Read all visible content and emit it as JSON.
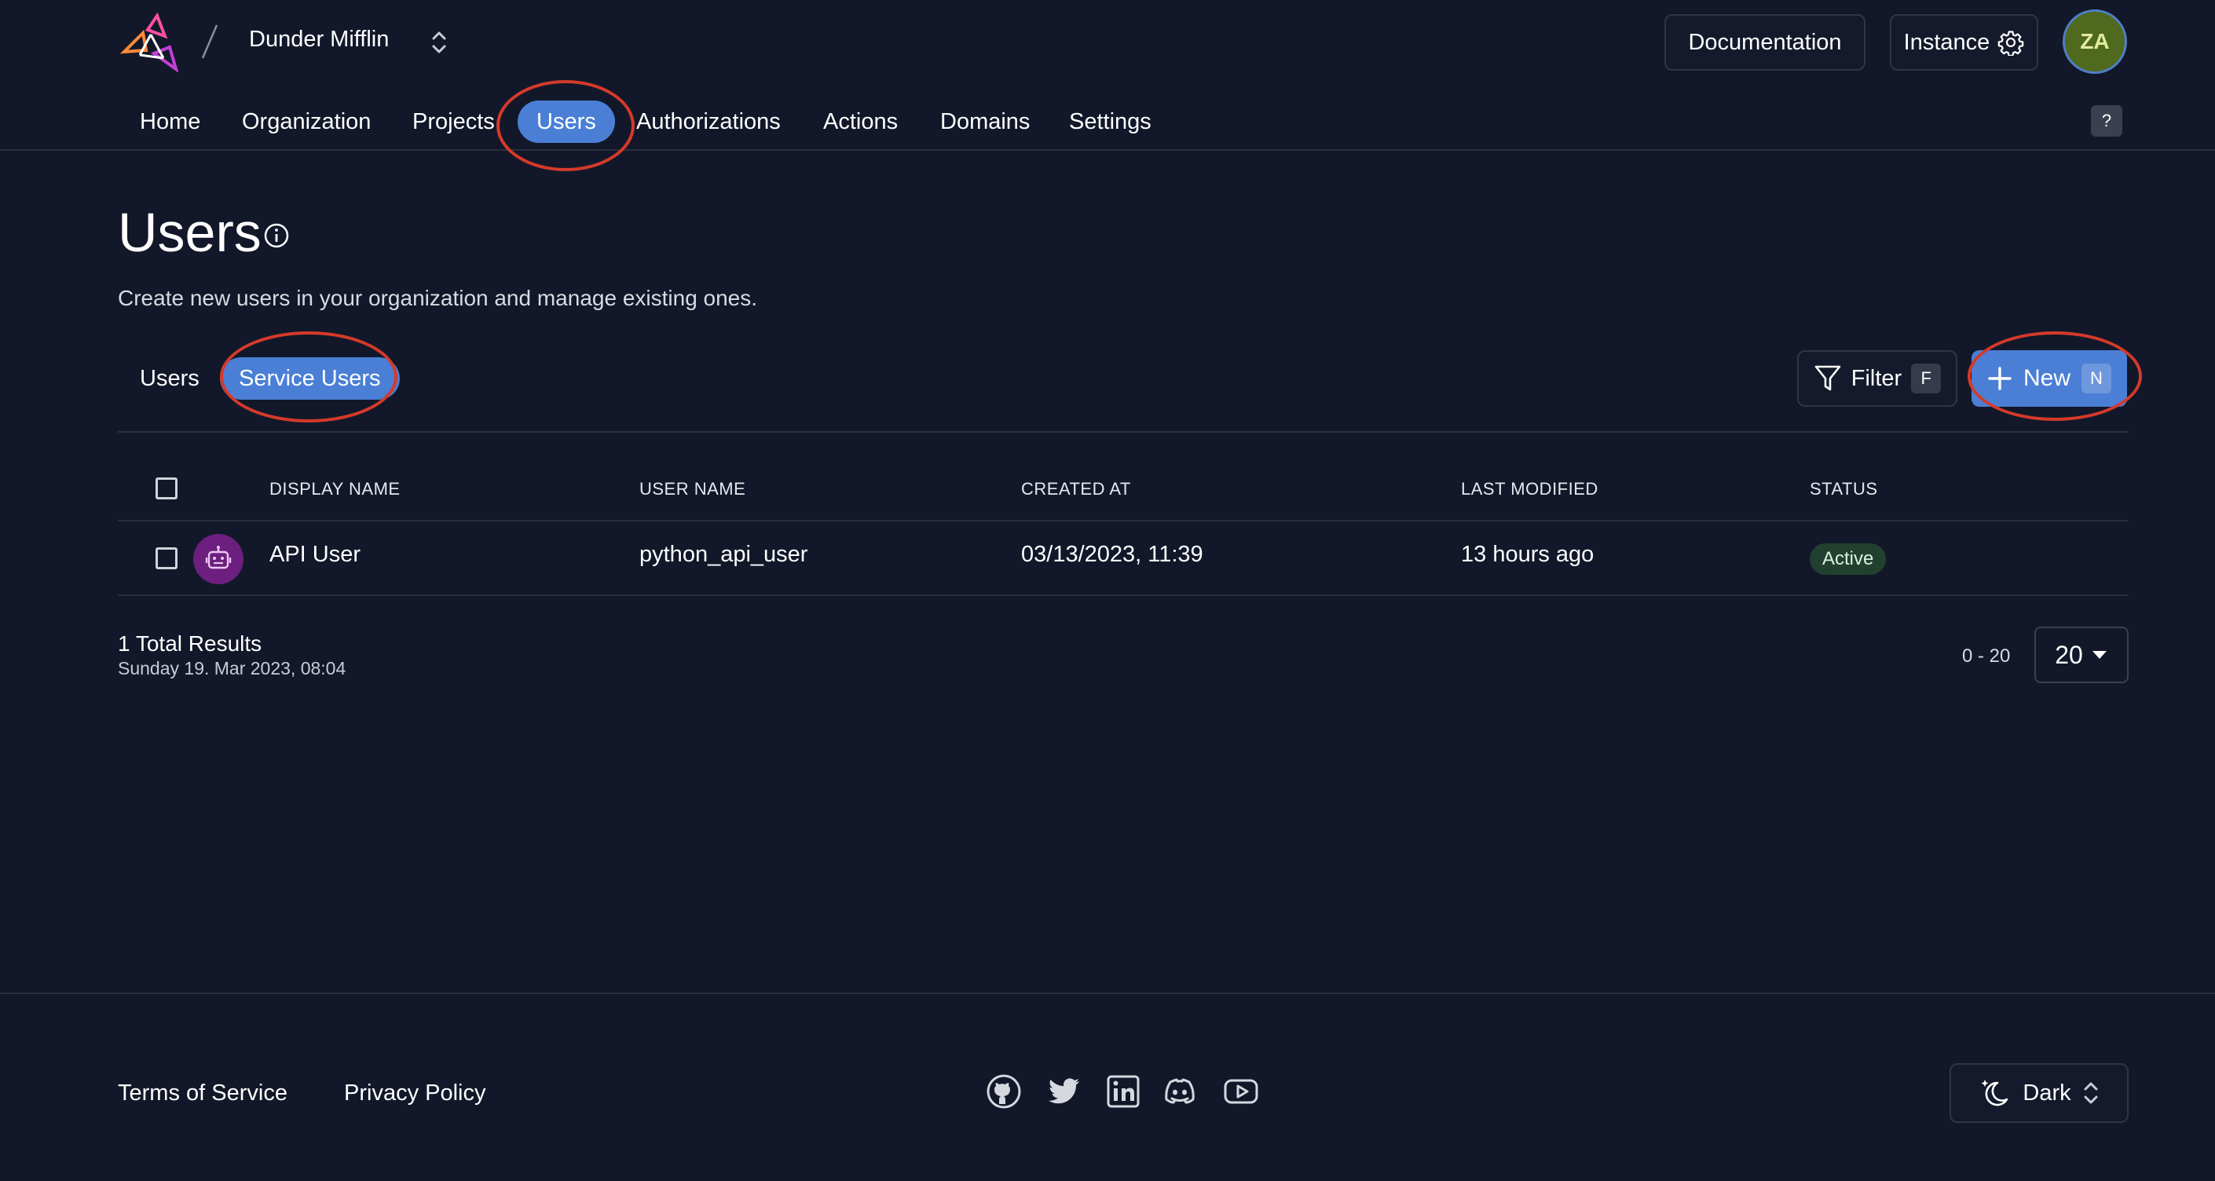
{
  "header": {
    "org_name": "Dunder Mifflin",
    "documentation_label": "Documentation",
    "instance_label": "Instance",
    "avatar_initials": "ZA"
  },
  "nav": {
    "items": [
      {
        "label": "Home"
      },
      {
        "label": "Organization"
      },
      {
        "label": "Projects"
      },
      {
        "label": "Users",
        "active": true
      },
      {
        "label": "Authorizations"
      },
      {
        "label": "Actions"
      },
      {
        "label": "Domains"
      },
      {
        "label": "Settings"
      }
    ],
    "help_label": "?"
  },
  "page": {
    "title": "Users",
    "description": "Create new users in your organization and manage existing ones."
  },
  "subtabs": [
    {
      "label": "Users"
    },
    {
      "label": "Service Users",
      "active": true
    }
  ],
  "toolbar": {
    "filter_label": "Filter",
    "filter_shortcut": "F",
    "new_label": "New",
    "new_shortcut": "N"
  },
  "table": {
    "columns": [
      "DISPLAY NAME",
      "USER NAME",
      "CREATED AT",
      "LAST MODIFIED",
      "STATUS"
    ],
    "rows": [
      {
        "display_name": "API User",
        "user_name": "python_api_user",
        "created_at": "03/13/2023, 11:39",
        "last_modified": "13 hours ago",
        "status": "Active"
      }
    ]
  },
  "results": {
    "total": "1 Total Results",
    "timestamp": "Sunday 19. Mar 2023, 08:04",
    "range": "0 - 20",
    "page_size": "20"
  },
  "footer": {
    "terms": "Terms of Service",
    "privacy": "Privacy Policy",
    "social_icons": [
      "github-icon",
      "twitter-icon",
      "linkedin-icon",
      "discord-icon",
      "youtube-icon"
    ],
    "theme_label": "Dark"
  },
  "colors": {
    "background": "#121829",
    "accent": "#4a7fd5",
    "annotation": "#d53a2a",
    "status_active_bg": "#21402f"
  }
}
